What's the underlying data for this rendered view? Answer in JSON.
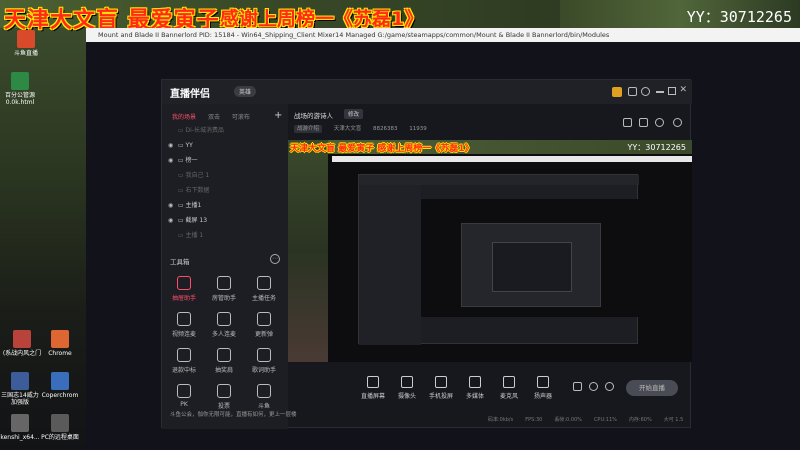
{
  "banner": {
    "main": "天津大文盲 最爱寅子",
    "sub": "感谢上周榜一《苏磊1》",
    "yy": "YY：30712265"
  },
  "window_title": "Mount and Blade II Bannerlord PID: 15184 - Win64_Shipping_Client Mixer14 Managed G:/game/steamapps/common/Mount & Blade II Bannerlord/bin/Modules",
  "desktop": {
    "icons": [
      {
        "label": "斗鱼直播",
        "color": "#d84a2a"
      },
      {
        "label": "百分公管源 0.0k.html",
        "color": "#2d8a45"
      },
      {
        "label": "(系战内风之门",
        "color": "#b9433a"
      },
      {
        "label": "Chrome",
        "color": "#dd6633"
      },
      {
        "label": "三国志14威力加强版",
        "color": "#3d5d9a"
      },
      {
        "label": "Coperchrom",
        "color": "#3a6ebd"
      },
      {
        "label": "kenshi_x64...",
        "color": "#666666"
      },
      {
        "label": "PC的远程桌面",
        "color": "#5a5a5a"
      }
    ]
  },
  "app": {
    "logo": "直播伴侣",
    "badge": "英雄",
    "sidebar": {
      "tabs": [
        "我的场景",
        "双击",
        "可滚布"
      ],
      "sources": [
        {
          "name": "Di-长城消费品",
          "on": false
        },
        {
          "name": "YY",
          "on": true
        },
        {
          "name": "榜一",
          "on": true
        },
        {
          "name": "我自己 1",
          "on": false
        },
        {
          "name": "右下数据",
          "on": false
        },
        {
          "name": "主播1",
          "on": true
        },
        {
          "name": "截屏 13",
          "on": true
        },
        {
          "name": "主播 1",
          "on": false
        }
      ],
      "tools_title": "工具箱",
      "tools": [
        "抽屉助手",
        "房管助手",
        "主播任务",
        "视频连麦",
        "多人连麦",
        "更新弹",
        "退款中标",
        "抽奖肩",
        "歌词助手",
        "PK",
        "投票",
        "斗鱼"
      ],
      "status": "斗鱼公会，伽你无限可能，直播有如何，更上一层楼"
    },
    "main": {
      "room": "战场的游诗人",
      "tag": "修改",
      "meta": [
        "战游介绍",
        "天津大文盲",
        "8826383",
        "11939"
      ],
      "preview_banner": "天津大文盲 最爱寅子 感谢上周榜一《苏磊1》",
      "preview_yy": "YY：30712265",
      "bottom": [
        "直播屏幕",
        "摄像头",
        "手机投屏",
        "多媒体",
        "麦克风",
        "扬声器"
      ],
      "start": "开始直播",
      "statusbar": [
        "码率:0kb/s",
        "FPS:30",
        "丢帧:0.00%",
        "CPU:11%",
        "内存:60%",
        "大可 1.5"
      ]
    }
  }
}
